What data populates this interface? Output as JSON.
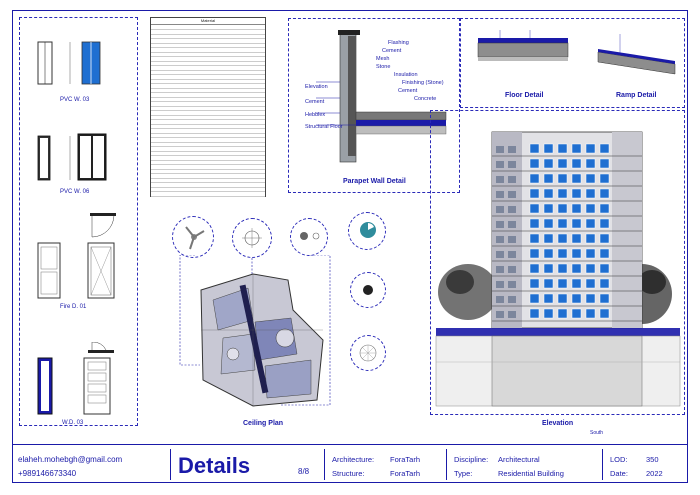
{
  "left_panel": {
    "items": [
      {
        "label": "PVC W. 03"
      },
      {
        "label": "PVC W. 06"
      },
      {
        "label": "Fire D. 01"
      },
      {
        "label": "W.D. 03"
      }
    ]
  },
  "material_table": {
    "title": "Material",
    "rows": 38
  },
  "parapet": {
    "caption": "Parapet Wall Detail",
    "labels_right": [
      "Flashing",
      "Cement",
      "Mesh",
      "Stone",
      "Insulation",
      "Finishing (Stone)",
      "Cement",
      "Concrete"
    ],
    "labels_left": [
      "Elevation",
      "Cement",
      "Hebblex",
      "Structural Floor"
    ]
  },
  "floor_detail": {
    "caption": "Floor Detail"
  },
  "ramp_detail": {
    "caption": "Ramp Detail"
  },
  "ceiling": {
    "caption": "Ceiling Plan"
  },
  "elevation": {
    "caption": "Elevation",
    "subcaption": "South"
  },
  "title_block": {
    "email": "elaheh.mohebgh@gmail.com",
    "phone": "+989146673340",
    "title": "Details",
    "sheet": "8/8",
    "architecture_label": "Architecture:",
    "architecture_value": "ForaTarh",
    "structure_label": "Structure:",
    "structure_value": "ForaTarh",
    "discipline_label": "Discipline:",
    "discipline_value": "Architectural",
    "type_label": "Type:",
    "type_value": "Residential Building",
    "lod_label": "LOD:",
    "lod_value": "350",
    "date_label": "Date:",
    "date_value": "2022"
  },
  "colors": {
    "accent": "#1a1aa8",
    "glass": "#1f6fd1",
    "dark": "#1c1c1c"
  }
}
